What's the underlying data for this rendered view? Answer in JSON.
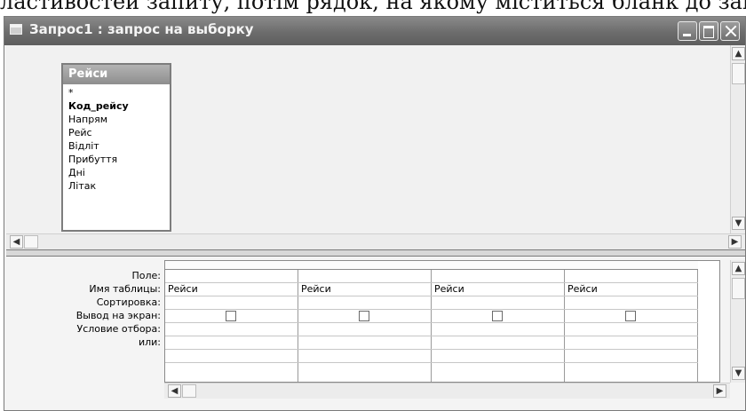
{
  "background_text": "ластивостей запиту, потім рядок, на якому міститься бланк до запиту",
  "window": {
    "title": "Запрос1 : запрос на выборку"
  },
  "table_box": {
    "title": "Рейси",
    "fields": [
      "*",
      "Код_рейсу",
      "Напрям",
      "Рейс",
      "Відліт",
      "Прибуття",
      "Дні",
      "Літак"
    ],
    "key_field": "Код_рейсу"
  },
  "design_grid": {
    "row_labels": {
      "field": "Поле:",
      "table": "Имя таблицы:",
      "sort": "Сортировка:",
      "show": "Вывод на экран:",
      "criteria": "Условие отбора:",
      "or": "или:"
    },
    "columns": [
      {
        "field": "",
        "table": "Рейси",
        "sort": "",
        "show": false
      },
      {
        "field": "",
        "table": "Рейси",
        "sort": "",
        "show": false
      },
      {
        "field": "",
        "table": "Рейси",
        "sort": "",
        "show": false
      },
      {
        "field": "",
        "table": "Рейси",
        "sort": "",
        "show": false
      }
    ]
  },
  "icons": {
    "scroll_up": "▲",
    "scroll_down": "▼",
    "scroll_left": "◀",
    "scroll_right": "▶"
  }
}
